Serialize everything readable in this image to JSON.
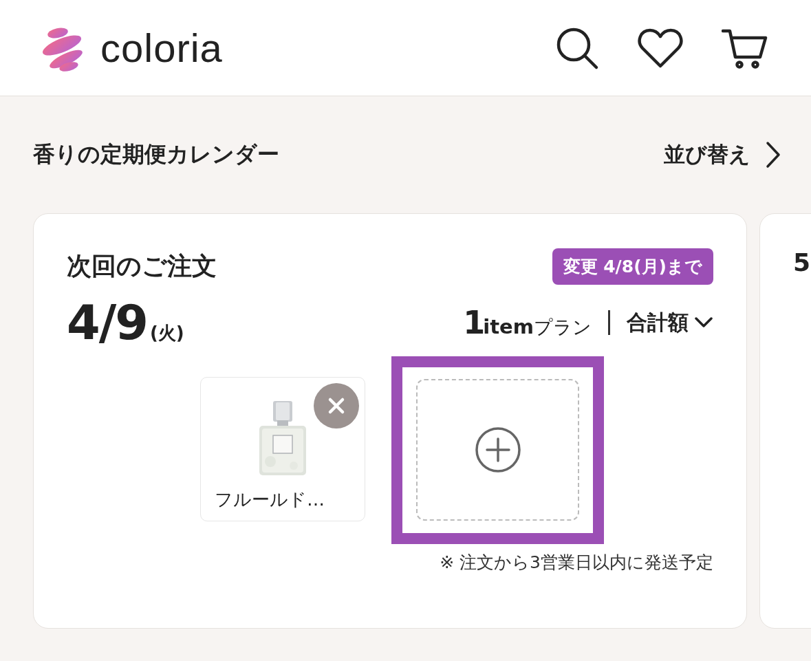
{
  "header": {
    "logo": "coloria"
  },
  "section": {
    "title": "香りの定期便カレンダー",
    "sort_link": "並び替え"
  },
  "orders": [
    {
      "title": "次回のご注文",
      "deadline_badge": "変更 4/8(月)まで",
      "date": "4/9",
      "weekday": "(火)",
      "plan_count": "1",
      "plan_unit": "item",
      "plan_suffix": "プラン",
      "total_toggle": "合計額",
      "items": [
        {
          "name": "フルールド…"
        }
      ],
      "add_slot": {
        "highlighted": true
      },
      "note": "※ 注文から3営業日以内に発送予定"
    },
    {
      "title": "5"
    }
  ]
}
